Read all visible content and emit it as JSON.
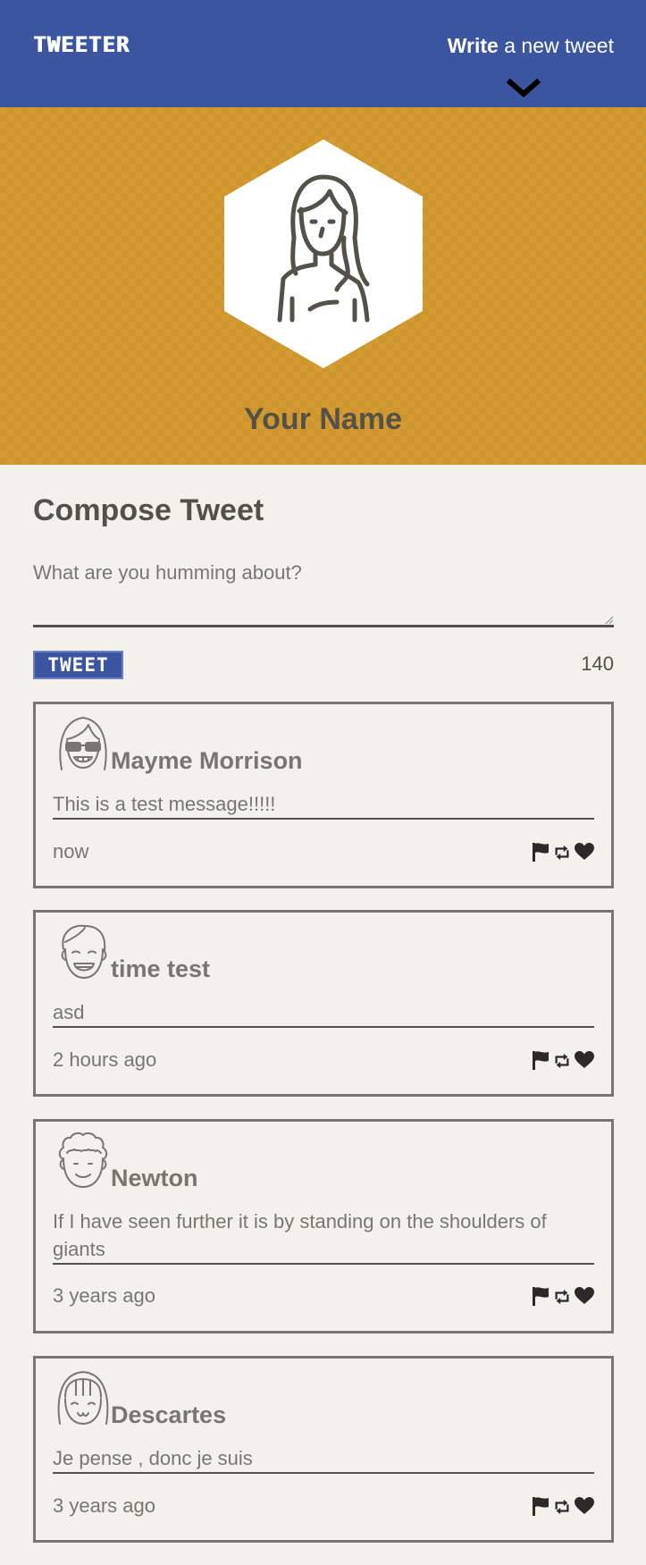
{
  "nav": {
    "logo": "TWEETER",
    "compose_strong": "Write",
    "compose_rest": " a new tweet",
    "toggle_icon": "chevron-down-icon"
  },
  "header": {
    "avatar_icon": "girl-avatar-icon",
    "user_name": "Your Name"
  },
  "compose": {
    "title": "Compose Tweet",
    "placeholder": "What are you humming about?",
    "button_label": "TWEET",
    "counter": "140"
  },
  "tweets": [
    {
      "avatar": "sunglasses-avatar-icon",
      "author": "Mayme Morrison",
      "content": "This is a test message!!!!!",
      "time": "now"
    },
    {
      "avatar": "smiling-man-avatar-icon",
      "author": "time test",
      "content": "asd",
      "time": "2 hours ago"
    },
    {
      "avatar": "curly-hair-avatar-icon",
      "author": "Newton",
      "content": "If I have seen further it is by standing on the shoulders of giants",
      "time": "3 years ago"
    },
    {
      "avatar": "bob-hair-avatar-icon",
      "author": "Descartes",
      "content": "Je pense , donc je suis",
      "time": "3 years ago"
    }
  ],
  "action_icons": [
    "flag-icon",
    "retweet-icon",
    "heart-icon"
  ],
  "colors": {
    "nav": "#3c55a0",
    "header": "#d59a30",
    "background": "#f4f1ed",
    "text": "#545149",
    "muted": "#7a766f"
  }
}
